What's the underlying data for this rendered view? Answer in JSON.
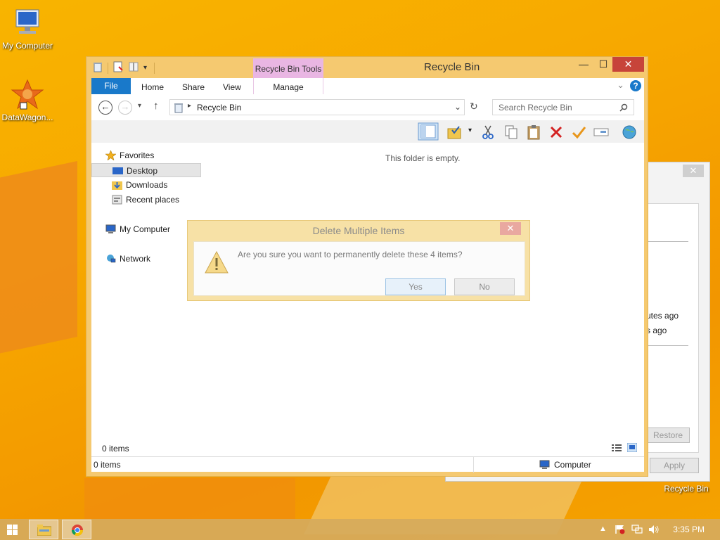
{
  "desktop": {
    "icons": [
      {
        "label": "My Computer"
      },
      {
        "label": "DataWagon..."
      },
      {
        "label": "Recycle Bin"
      }
    ]
  },
  "back_window": {
    "close_label": "✕",
    "text1": "utes ago",
    "text2": "s ago",
    "restore_label": "Restore",
    "apply_label": "Apply"
  },
  "window": {
    "title": "Recycle Bin",
    "context_tab": "Recycle Bin Tools",
    "ribbon_tabs": {
      "file": "File",
      "home": "Home",
      "share": "Share",
      "view": "View",
      "manage": "Manage"
    },
    "controls": {
      "minimize": "—",
      "maximize": "☐",
      "close": "✕"
    },
    "address": {
      "location": "Recycle Bin"
    },
    "search": {
      "placeholder": "Search Recycle Bin"
    },
    "navpane": {
      "favorites": "Favorites",
      "desktop": "Desktop",
      "downloads": "Downloads",
      "recent": "Recent places",
      "computer": "My Computer",
      "network": "Network"
    },
    "empty_message": "This folder is empty.",
    "items_count": "0 items",
    "status": {
      "items": "0 items",
      "location": "Computer"
    }
  },
  "dialog": {
    "title": "Delete Multiple Items",
    "message": "Are you sure you want to permanently delete these 4 items?",
    "yes": "Yes",
    "no": "No",
    "close": "✕"
  },
  "taskbar": {
    "clock": "3:35 PM"
  },
  "colors": {
    "accent": "#1979ca",
    "window_frame": "#f5c970",
    "context_tab": "#e9b6e3",
    "close_button": "#c7443a"
  }
}
